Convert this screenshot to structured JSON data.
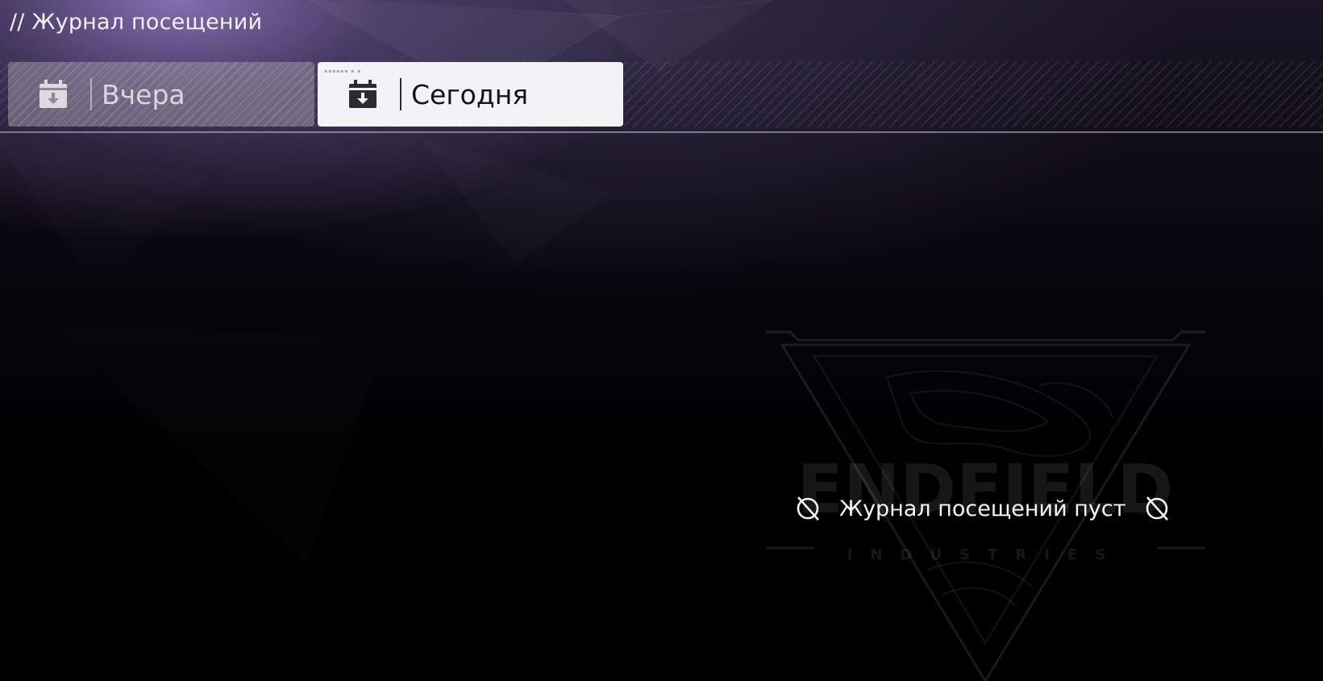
{
  "page": {
    "title": "// Журнал посещений"
  },
  "tabs": [
    {
      "label": "Вчера",
      "icon": "calendar-download-icon",
      "selected": false
    },
    {
      "label": "Сегодня",
      "icon": "calendar-download-icon",
      "selected": true
    }
  ],
  "empty_state": {
    "message": "Журнал посещений пуст",
    "icon": "ban-icon"
  },
  "watermark": {
    "line1": "ENDFIELD",
    "line2": "INDUSTRIES"
  },
  "colors": {
    "accent_purple": "#8c78c0",
    "tab_selected_bg": "#f3f2f5",
    "tab_unselected_bg": "#8f8a9a",
    "text_light": "#f4f4f6"
  }
}
